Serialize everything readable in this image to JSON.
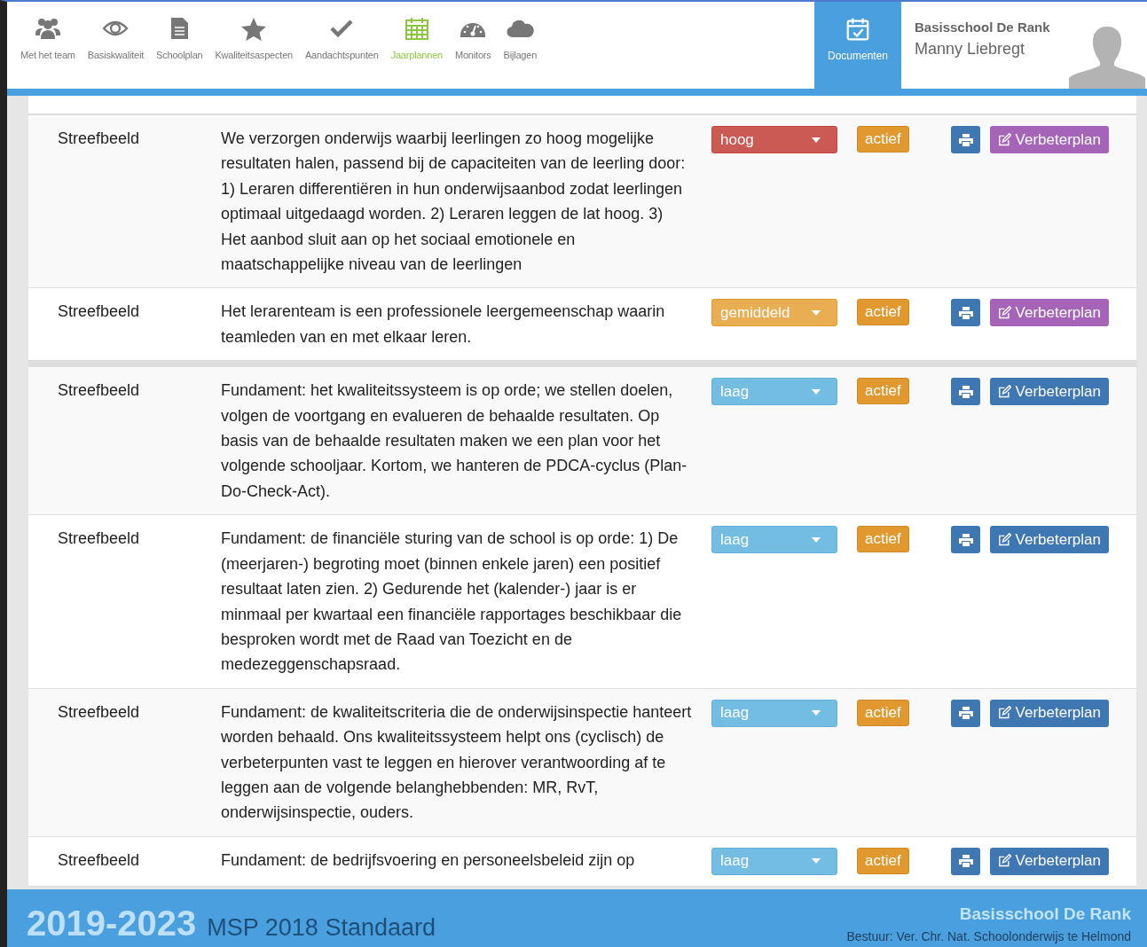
{
  "nav": [
    {
      "label": "Met het team",
      "selected": false
    },
    {
      "label": "Basiskwaliteit",
      "selected": false
    },
    {
      "label": "Schoolplan",
      "selected": false
    },
    {
      "label": "Kwaliteitsaspecten",
      "selected": false
    },
    {
      "label": "Aandachtspunten",
      "selected": false
    },
    {
      "label": "Jaarplannen",
      "selected": true
    },
    {
      "label": "Monitors",
      "selected": false
    },
    {
      "label": "Bijlagen",
      "selected": false
    }
  ],
  "documents_tab": {
    "label": "Documenten",
    "selected": true
  },
  "user": {
    "school": "Basisschool De Rank",
    "name": "Manny Liebregt"
  },
  "groups": [
    {
      "rows": [
        {
          "type": "Streefbeeld",
          "text": "We verzorgen onderwijs waarbij leerlingen zo hoog mogelijke resultaten halen, passend bij de capaciteiten van de leerling door: 1) Leraren differentiëren in hun onderwijsaanbod zodat leerlingen optimaal uitgedaagd worden. 2) Leraren leggen de lat hoog. 3) Het aanbod sluit aan op het sociaal emotionele en maatschappelijke niveau van de leerlingen",
          "priority": "hoog",
          "kind": "high",
          "status": "actief",
          "plan": "Verbeterplan",
          "plan_exists": true
        },
        {
          "type": "Streefbeeld",
          "text": "Het lerarenteam is een professionele leergemeenschap waarin teamleden van en met elkaar leren.",
          "priority": "gemiddeld",
          "kind": "medium",
          "status": "actief",
          "plan": "Verbeterplan",
          "plan_exists": true
        }
      ]
    },
    {
      "rows": [
        {
          "type": "Streefbeeld",
          "text": "Fundament: het kwaliteitssysteem is op orde; we stellen doelen, volgen de voortgang en evalueren de behaalde resultaten. Op basis van de behaalde resultaten maken we een plan voor het volgende schooljaar. Kortom, we hanteren de PDCA-cyclus (Plan-Do-Check-Act).",
          "priority": "laag",
          "kind": "low",
          "status": "actief",
          "plan": "Verbeterplan",
          "plan_exists": false
        },
        {
          "type": "Streefbeeld",
          "text": "Fundament: de financiële sturing van de school is op orde: 1) De (meerjaren-) begroting moet (binnen enkele jaren) een positief resultaat laten zien. 2) Gedurende het (kalender-) jaar is er minmaal per kwartaal een financiële rapportages beschikbaar die besproken wordt met de Raad van Toezicht en de medezeggenschapsraad.",
          "priority": "laag",
          "kind": "low",
          "status": "actief",
          "plan": "Verbeterplan",
          "plan_exists": false
        },
        {
          "type": "Streefbeeld",
          "text": "Fundament: de kwaliteitscriteria die de onderwijsinspectie hanteert worden behaald. Ons kwaliteitssysteem helpt ons (cyclisch) de verbeterpunten vast te leggen en hierover verantwoording af te leggen aan de volgende belanghebbenden: MR, RvT, onderwijsinspectie, ouders.",
          "priority": "laag",
          "kind": "low",
          "status": "actief",
          "plan": "Verbeterplan",
          "plan_exists": false
        },
        {
          "type": "Streefbeeld",
          "text": "Fundament: de bedrijfsvoering en personeelsbeleid zijn op",
          "priority": "laag",
          "kind": "low",
          "status": "actief",
          "plan": "Verbeterplan",
          "plan_exists": false
        }
      ]
    }
  ],
  "footer": {
    "years": "2019-2023",
    "title": "MSP 2018 Standaard",
    "school": "Basisschool De Rank",
    "board": "Bestuur: Ver. Chr. Nat. Schoolonderwijs te Helmond"
  }
}
